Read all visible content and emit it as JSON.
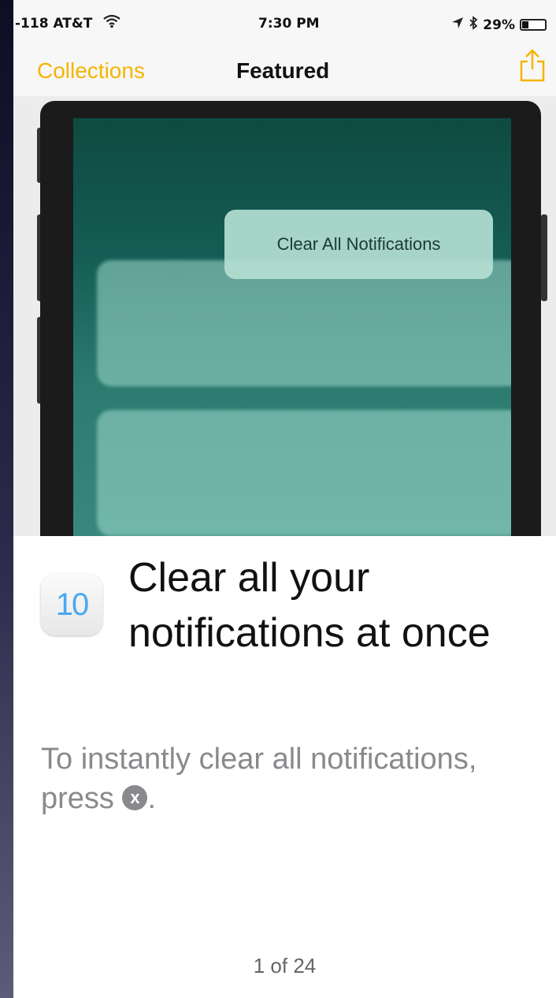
{
  "status_bar": {
    "carrier": "-118 AT&T",
    "time": "7:30 PM",
    "battery": "29%",
    "battery_level": 0.29
  },
  "nav": {
    "back_label": "Collections",
    "title": "Featured",
    "share_icon": "share-icon"
  },
  "hero": {
    "popup_label": "Clear All Notifications"
  },
  "tip": {
    "badge": "10",
    "headline": "Clear all your notifications at once",
    "body_before": "To instantly clear all notifications, press",
    "body_symbol": "x",
    "body_after": "."
  },
  "pager": {
    "label": "1 of 24"
  },
  "colors": {
    "accent": "#f5b400",
    "body_text": "#8a8a8e"
  }
}
